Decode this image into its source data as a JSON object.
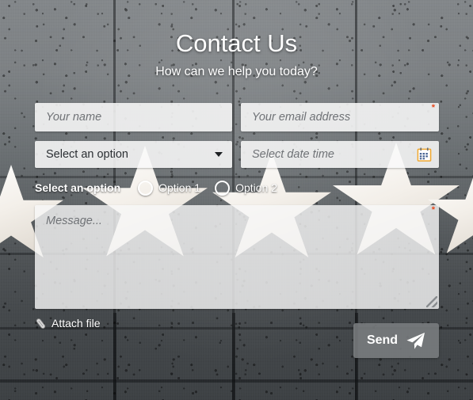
{
  "header": {
    "title": "Contact Us",
    "subtitle": "How can we help you today?"
  },
  "form": {
    "name": {
      "placeholder": "Your name",
      "value": ""
    },
    "email": {
      "placeholder": "Your email address",
      "value": "",
      "required_marker": "*"
    },
    "select": {
      "value": "Select an option",
      "caret": "chevron-down-icon"
    },
    "date": {
      "placeholder": "Select date time",
      "value": "",
      "icon": "calendar-icon"
    },
    "radio_group": {
      "label": "Select an option",
      "options": [
        {
          "label": "Option 1",
          "selected": false
        },
        {
          "label": "Option 2",
          "selected": false
        }
      ]
    },
    "message": {
      "placeholder": "Message...",
      "value": "",
      "required_marker": "*"
    },
    "attach": {
      "label": "Attach file",
      "icon": "paperclip-icon"
    },
    "submit": {
      "label": "Send",
      "icon": "paper-plane-icon"
    }
  },
  "colors": {
    "required_asterisk": "#e8481c",
    "field_background": "#f8f8f8",
    "button_background": "#7a7d80",
    "text_on_dark": "#ffffff",
    "placeholder": "#6f7276",
    "calendar_icon_border": "#f0a830",
    "calendar_icon_grid": "#3d5a8c"
  }
}
